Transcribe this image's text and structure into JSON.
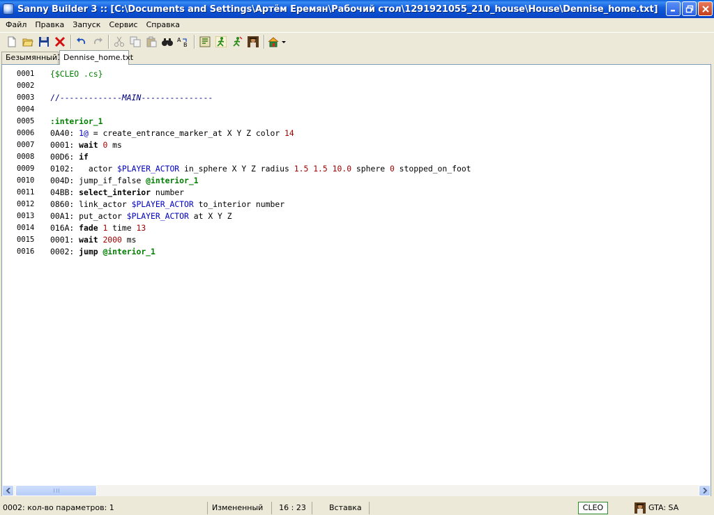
{
  "window": {
    "title": "Sanny Builder 3 :: [C:\\Documents and Settings\\Артём Еремян\\Рабочий стол\\1291921055_210_house\\House\\Dennise_home.txt]"
  },
  "menu": {
    "items": [
      "Файл",
      "Правка",
      "Запуск",
      "Сервис",
      "Справка"
    ]
  },
  "toolbar": {
    "icons": [
      "new-file-icon",
      "open-folder-icon",
      "save-icon",
      "close-file-icon",
      "undo-icon",
      "redo-icon",
      "cut-icon",
      "copy-icon",
      "paste-icon",
      "find-icon",
      "replace-icon",
      "compile-icon",
      "compile-run-icon",
      "run-icon",
      "game-icon",
      "home-dropdown-icon"
    ]
  },
  "tabs": [
    {
      "label": "Безымянный1",
      "active": false
    },
    {
      "label": "Dennise_home.txt",
      "active": true
    }
  ],
  "editor": {
    "lines": [
      {
        "n": "0001",
        "text": "{$CLEO .cs}"
      },
      {
        "n": "0002",
        "text": ""
      },
      {
        "n": "0003",
        "text": "//-------------MAIN---------------"
      },
      {
        "n": "0004",
        "text": ""
      },
      {
        "n": "0005",
        "text": ":interior_1"
      },
      {
        "n": "0006",
        "text": "0A40: 1@ = create_entrance_marker_at X Y Z color 14"
      },
      {
        "n": "0007",
        "text": "0001: wait 0 ms"
      },
      {
        "n": "0008",
        "text": "00D6: if"
      },
      {
        "n": "0009",
        "text": "0102:   actor $PLAYER_ACTOR in_sphere X Y Z radius 1.5 1.5 10.0 sphere 0 stopped_on_foot"
      },
      {
        "n": "0010",
        "text": "004D: jump_if_false @interior_1"
      },
      {
        "n": "0011",
        "text": "04BB: select_interior number"
      },
      {
        "n": "0012",
        "text": "0860: link_actor $PLAYER_ACTOR to_interior number"
      },
      {
        "n": "0013",
        "text": "00A1: put_actor $PLAYER_ACTOR at X Y Z"
      },
      {
        "n": "0014",
        "text": "016A: fade 1 time 13"
      },
      {
        "n": "0015",
        "text": "0001: wait 2000 ms"
      },
      {
        "n": "0016",
        "text": "0002: jump @interior_1"
      }
    ]
  },
  "status": {
    "params": "0002: кол-во параметров: 1",
    "modified": "Измененный",
    "position": "16 : 23",
    "mode": "Вставка",
    "cleo": "CLEO",
    "game": "GTA: SA"
  },
  "colors": {
    "label": "#007f00",
    "variable": "#0000c0",
    "number": "#a00000"
  }
}
